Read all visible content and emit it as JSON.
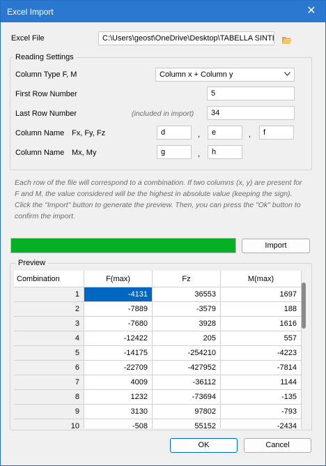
{
  "window": {
    "title": "Excel Import",
    "close_glyph": "✕"
  },
  "file": {
    "label": "Excel File",
    "path": "C:\\Users\\geost\\OneDrive\\Desktop\\TABELLA SINTE"
  },
  "reading": {
    "title": "Reading Settings",
    "column_type_label": "Column Type F, M",
    "column_type_value": "Column x + Column y",
    "first_row_label": "First Row Number",
    "first_row_value": "5",
    "last_row_label": "Last Row Number",
    "last_row_note": "(included in import)",
    "last_row_value": "34",
    "fxyz_label": "Column Name",
    "fxyz_sub": "Fx, Fy, Fz",
    "fxyz_values": [
      "d",
      "e",
      "f"
    ],
    "mxy_label": "Column Name",
    "mxy_sub": "Mx, My",
    "mxy_values": [
      "g",
      "h"
    ],
    "comma": ","
  },
  "note": "Each row of the file will correspond to a combination. If two columns (x, y) are present for F and M, the value considered will be the highest in absolute value (keeping the sign). Click the \"Import\" button to generate the preview. Then, you can press the \"Ok\" button to confirm the import.",
  "progress": {
    "fraction": 1.0,
    "color": "#06b025"
  },
  "import_button": "Import",
  "preview": {
    "title": "Preview",
    "columns": [
      "Combination",
      "F(max)",
      "Fz",
      "M(max)"
    ],
    "rows": [
      [
        "1",
        "-4131",
        "36553",
        "1697"
      ],
      [
        "2",
        "-7889",
        "-3579",
        "188"
      ],
      [
        "3",
        "-7680",
        "3928",
        "1616"
      ],
      [
        "4",
        "-12422",
        "205",
        "557"
      ],
      [
        "5",
        "-14175",
        "-254210",
        "-4223"
      ],
      [
        "6",
        "-22709",
        "-427952",
        "-7814"
      ],
      [
        "7",
        "4009",
        "-36112",
        "1144"
      ],
      [
        "8",
        "1232",
        "-73694",
        "-135"
      ],
      [
        "9",
        "3130",
        "97802",
        "-793"
      ],
      [
        "10",
        "-508",
        "55152",
        "-2434"
      ]
    ]
  },
  "buttons": {
    "ok": "OK",
    "cancel": "Cancel"
  },
  "colors": {
    "titlebar": "#2b78d0",
    "selection": "#0067c0"
  },
  "icons": {
    "folder": "folder-open-icon",
    "chevron": "chevron-down-icon",
    "close": "close-icon"
  }
}
